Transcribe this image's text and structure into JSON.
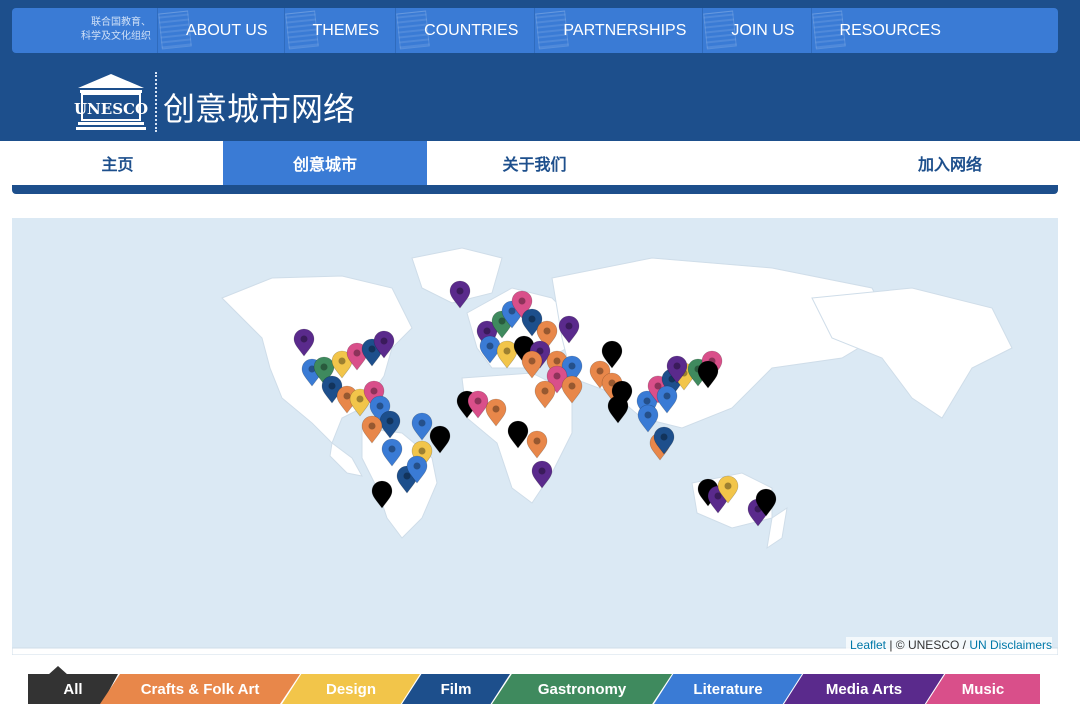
{
  "top_nav": {
    "brand_line1": "联合国教育、",
    "brand_line2": "科学及文化组织",
    "items": [
      {
        "label": "ABOUT US"
      },
      {
        "label": "THEMES"
      },
      {
        "label": "COUNTRIES"
      },
      {
        "label": "PARTNERSHIPS"
      },
      {
        "label": "JOIN US"
      },
      {
        "label": "RESOURCES"
      }
    ]
  },
  "header": {
    "logo_text": "UNESCO",
    "site_title": "创意城市网络"
  },
  "sub_nav": {
    "tabs": [
      {
        "label": "主页",
        "active": false
      },
      {
        "label": "创意城市",
        "active": true
      },
      {
        "label": "关于我们",
        "active": false
      },
      {
        "label": "加入网络",
        "active": false
      }
    ]
  },
  "map": {
    "attribution_prefix": "Leaflet",
    "attribution_sep1": " | © UNESCO / ",
    "attribution_link": "UN Disclaimers",
    "water_color": "#dbe9f4",
    "land_color": "#ffffff"
  },
  "categories": [
    {
      "label": "All",
      "color": "#333333"
    },
    {
      "label": "Crafts & Folk Art",
      "color": "#e8874a"
    },
    {
      "label": "Design",
      "color": "#f2c54a"
    },
    {
      "label": "Film",
      "color": "#1d4f8c"
    },
    {
      "label": "Gastronomy",
      "color": "#3f8a5e"
    },
    {
      "label": "Literature",
      "color": "#3a7bd5"
    },
    {
      "label": "Media Arts",
      "color": "#5a2a8c"
    },
    {
      "label": "Music",
      "color": "#d94f8a"
    }
  ]
}
